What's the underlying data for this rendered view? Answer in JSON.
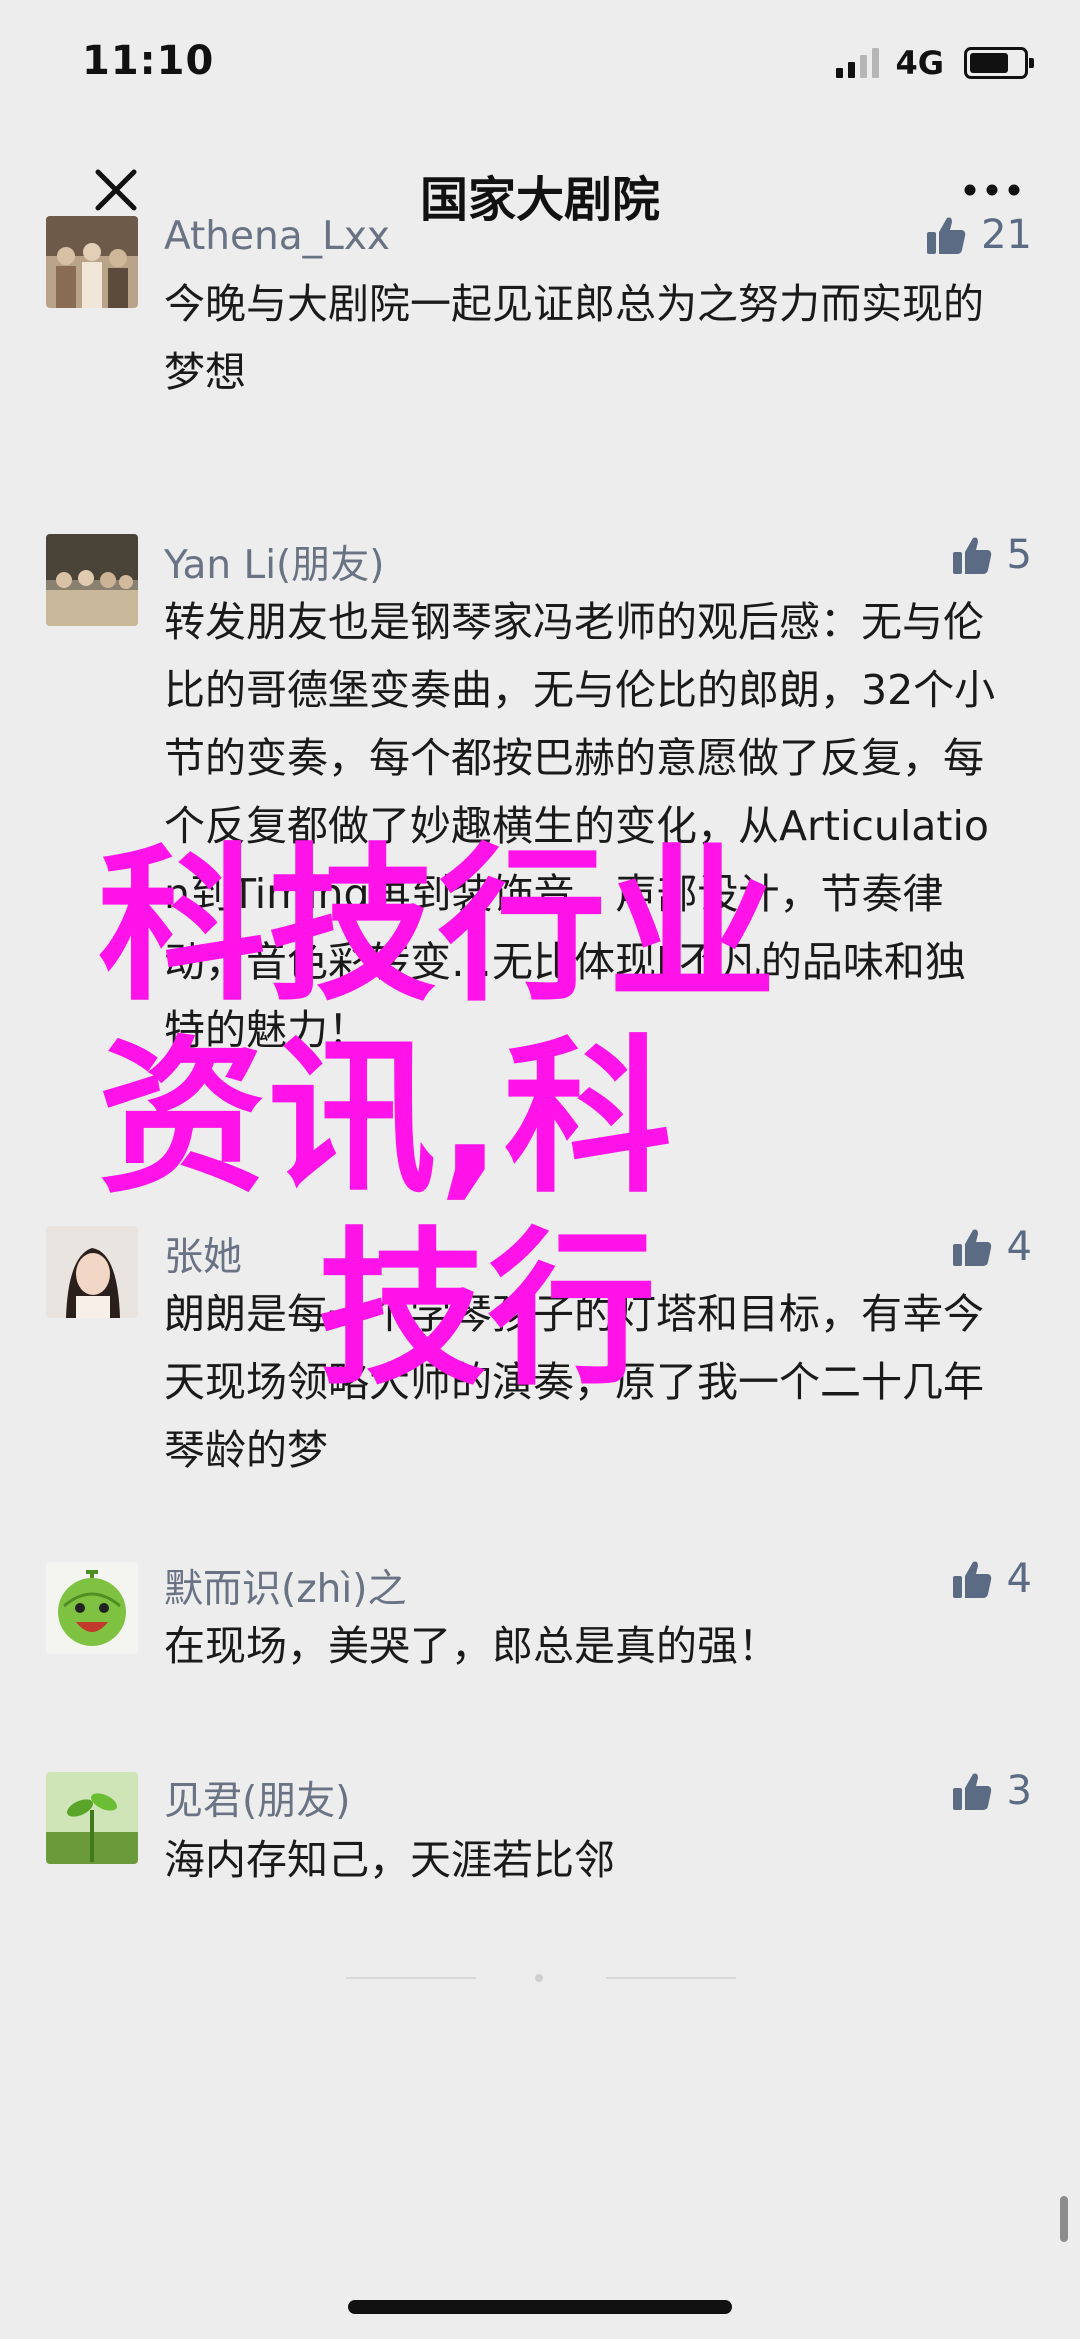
{
  "status_bar": {
    "time": "11:10",
    "network": "4G",
    "signal_icon": "cell-signal-icon",
    "battery_icon": "battery-icon"
  },
  "nav": {
    "title": "国家大剧院",
    "close_icon": "close-icon",
    "more_icon": "more-icon"
  },
  "comments": [
    {
      "name": "Athena_Lxx",
      "likes": "21",
      "text": "今晚与大剧院一起见证郎总为之努力而实现的梦想"
    },
    {
      "name": "Yan Li(朋友)",
      "likes": "5",
      "text": "转发朋友也是钢琴家冯老师的观后感：无与伦比的哥德堡变奏曲，无与伦比的郎朗，32个小节的变奏，每个都按巴赫的意愿做了反复，每个反复都做了妙趣横生的变化，从Articulation到Timing再到装饰音，声部设计，节奏律动，音色彩转变…无比体现L不凡的品味和独特的魅力！"
    },
    {
      "name": "张她",
      "likes": "4",
      "text": "朗朗是每一个学琴孩子的灯塔和目标，有幸今天现场领略大师的演奏，原了我一个二十几年琴龄的梦"
    },
    {
      "name": "默而识(zhì)之",
      "likes": "4",
      "text": "在现场，美哭了，郎总是真的强！"
    },
    {
      "name": "见君(朋友)",
      "likes": "3",
      "text": "海内存知己，天涯若比邻"
    }
  ],
  "watermark": [
    "科技行业",
    "资讯,科",
    "技行"
  ],
  "colors": {
    "watermark": "#ff13e8",
    "name": "#6a7384",
    "like": "#5b6b84",
    "background": "#ededed"
  }
}
